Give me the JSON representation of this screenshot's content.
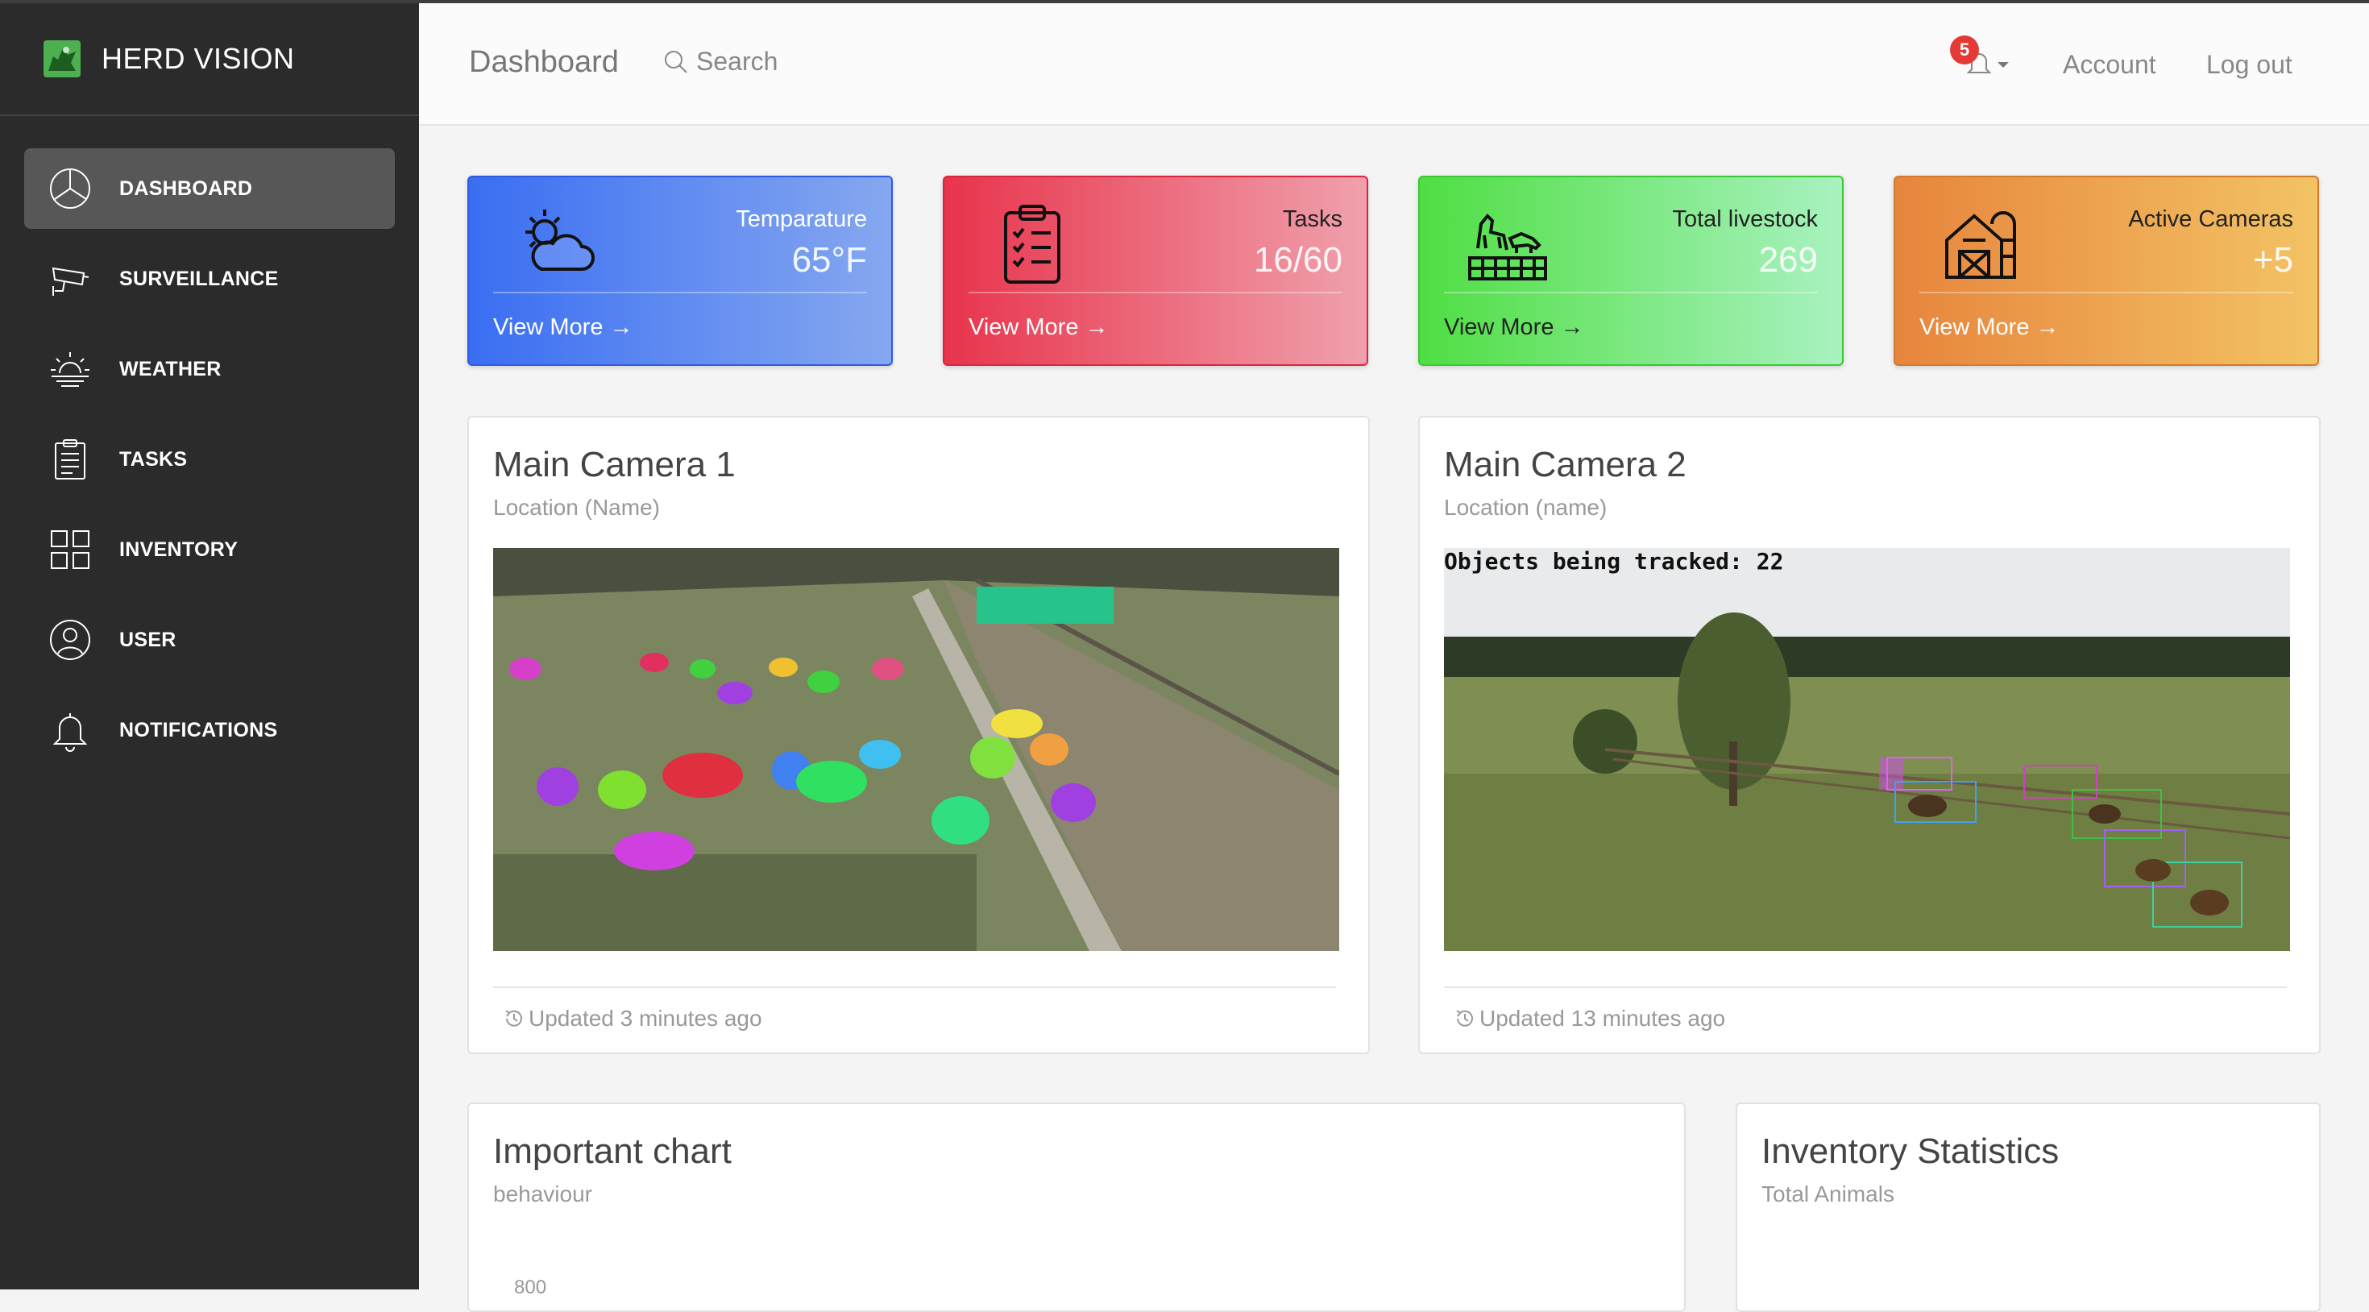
{
  "app": {
    "brand": "HERD VISION"
  },
  "sidebar": {
    "items": [
      {
        "label": "DASHBOARD",
        "icon": "pie-chart-icon",
        "active": true
      },
      {
        "label": "SURVEILLANCE",
        "icon": "cctv-camera-icon",
        "active": false
      },
      {
        "label": "WEATHER",
        "icon": "sunrise-icon",
        "active": false
      },
      {
        "label": "TASKS",
        "icon": "clipboard-icon",
        "active": false
      },
      {
        "label": "INVENTORY",
        "icon": "grid-icon",
        "active": false
      },
      {
        "label": "USER",
        "icon": "user-icon",
        "active": false
      },
      {
        "label": "NOTIFICATIONS",
        "icon": "bell-icon",
        "active": false
      }
    ]
  },
  "header": {
    "title": "Dashboard",
    "search_label": "Search",
    "notification_count": "5",
    "account_label": "Account",
    "logout_label": "Log out"
  },
  "stats": [
    {
      "title": "Temparature",
      "value": "65°F",
      "link": "View More →",
      "icon": "cloudy-sun-icon",
      "color": "#3a6ef2"
    },
    {
      "title": "Tasks",
      "value": "16/60",
      "link": "View More →",
      "icon": "clipboard-checklist-icon",
      "color": "#e8344c"
    },
    {
      "title": "Total livestock",
      "value": "269",
      "link": "View More →",
      "icon": "livestock-icon",
      "color": "#4fde43"
    },
    {
      "title": "Active Cameras",
      "value": "+5",
      "link": "View More →",
      "icon": "barn-icon",
      "color": "#e7853d"
    }
  ],
  "cameras": [
    {
      "title": "Main Camera 1",
      "location": "Location (Name)",
      "updated": "Updated 3 minutes ago"
    },
    {
      "title": "Main Camera 2",
      "location": "Location (name)",
      "updated": "Updated 13 minutes ago",
      "overlay": "Objects being tracked: 22"
    }
  ],
  "charts": [
    {
      "title": "Important chart",
      "subtitle": "behaviour",
      "tick": "800"
    },
    {
      "title": "Inventory Statistics",
      "subtitle": "Total Animals"
    }
  ]
}
